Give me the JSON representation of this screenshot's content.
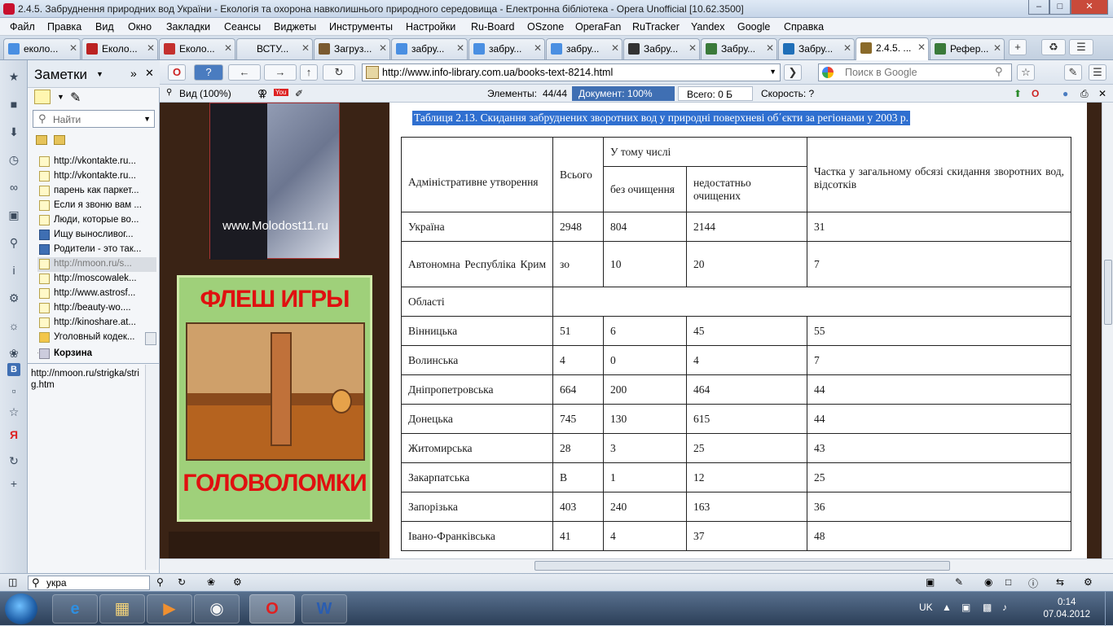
{
  "window": {
    "title": "2.4.5. Забруднення природних вод України - Екологія та охорона навколишнього природного середовища - Електронна бібліотека - Opera Unofficial [10.62.3500]"
  },
  "menu": [
    "Файл",
    "Правка",
    "Вид",
    "Окно",
    "Закладки",
    "Сеансы",
    "Виджеты",
    "Инструменты",
    "Настройки",
    "Ru-Board",
    "OSzone",
    "OperaFan",
    "RuTracker",
    "Yandex",
    "Google",
    "Справка"
  ],
  "tabs": [
    {
      "label": "еколо...",
      "color": "#4a8fe2"
    },
    {
      "label": "Еколо...",
      "color": "#b22"
    },
    {
      "label": "Еколо...",
      "color": "#c3302e"
    },
    {
      "label": "ВСТУ...",
      "color": "#777"
    },
    {
      "label": "Загруз...",
      "color": "#7a5a30"
    },
    {
      "label": "забру...",
      "color": "#4a8fe2"
    },
    {
      "label": "забру...",
      "color": "#4a8fe2"
    },
    {
      "label": "забру...",
      "color": "#4a8fe2"
    },
    {
      "label": "Забру...",
      "color": "#333"
    },
    {
      "label": "Забру...",
      "color": "#3a7a3a"
    },
    {
      "label": "Забру...",
      "color": "#1f6fb8"
    },
    {
      "label": "2.4.5. ...",
      "color": "#8a6a2a"
    },
    {
      "label": "Рефер...",
      "color": "#3a7a3a"
    }
  ],
  "notes": {
    "title": "Заметки",
    "find_placeholder": "Найти",
    "items": [
      "http://vkontakte.ru...",
      "http://vkontakte.ru...",
      "парень как паркет...",
      "Если я звоню вам ...",
      "Люди, которые во...",
      "Ищу выносливог...",
      "Родители - это так...",
      "http://nmoon.ru/s...",
      "http://moscowalek...",
      "http://www.astrosf...",
      "http://beauty-wo....",
      "http://kinoshare.at...",
      "Уголовный кодек..."
    ],
    "trash": "Корзина",
    "preview": "http://nmoon.ru/strigka/strig.htm"
  },
  "address": {
    "url": "http://www.info-library.com.ua/books-text-8214.html",
    "search_placeholder": "Поиск в Google"
  },
  "status": {
    "view": "Вид (100%)",
    "elements_label": "Элементы:",
    "elements": "44/44",
    "document": "Документ:  100%",
    "total": "Всего:   0 Б",
    "speed": "Скорость:  ?"
  },
  "ads": {
    "site": "www.Molodost11.ru",
    "top": "ФЛЕШ ИГРЫ",
    "bottom": "ГОЛОВОЛОМКИ"
  },
  "table": {
    "caption": "Таблиця 2.13. Скидання забруднених зворотних вод у природні поверхневі об΄єкти за регіонами у 2003 р.",
    "h_region": "Адміністративне утворення",
    "h_total": "Всього",
    "h_including": "У тому числі",
    "h_raw": "без очищення",
    "h_insuff": "недостатньо очищених",
    "h_share": "Частка у загальному обсязі скидання зворотних вод, відсотків",
    "rows": [
      [
        "Україна",
        "2948",
        "804",
        "2144",
        "31"
      ],
      [
        "Автономна Республіка Крим",
        "зо",
        "10",
        "20",
        "7"
      ],
      [
        "Області",
        "",
        "",
        "",
        ""
      ],
      [
        "Вінницька",
        "51",
        "6",
        "45",
        "55"
      ],
      [
        "Волинська",
        "4",
        "0",
        "4",
        "7"
      ],
      [
        "Дніпропетровська",
        "664",
        "200",
        "464",
        "44"
      ],
      [
        "Донецька",
        "745",
        "130",
        "615",
        "44"
      ],
      [
        "Житомирська",
        "28",
        "3",
        "25",
        "43"
      ],
      [
        "Закарпатська",
        "В",
        "1",
        "12",
        "25"
      ],
      [
        "Запорізька",
        "403",
        "240",
        "163",
        "36"
      ],
      [
        "Івано-Франківська",
        "41",
        "4",
        "37",
        "48"
      ]
    ]
  },
  "bottom": {
    "find_value": "укра"
  },
  "taskbar": {
    "lang": "UK",
    "time": "0:14",
    "date": "07.04.2012"
  }
}
